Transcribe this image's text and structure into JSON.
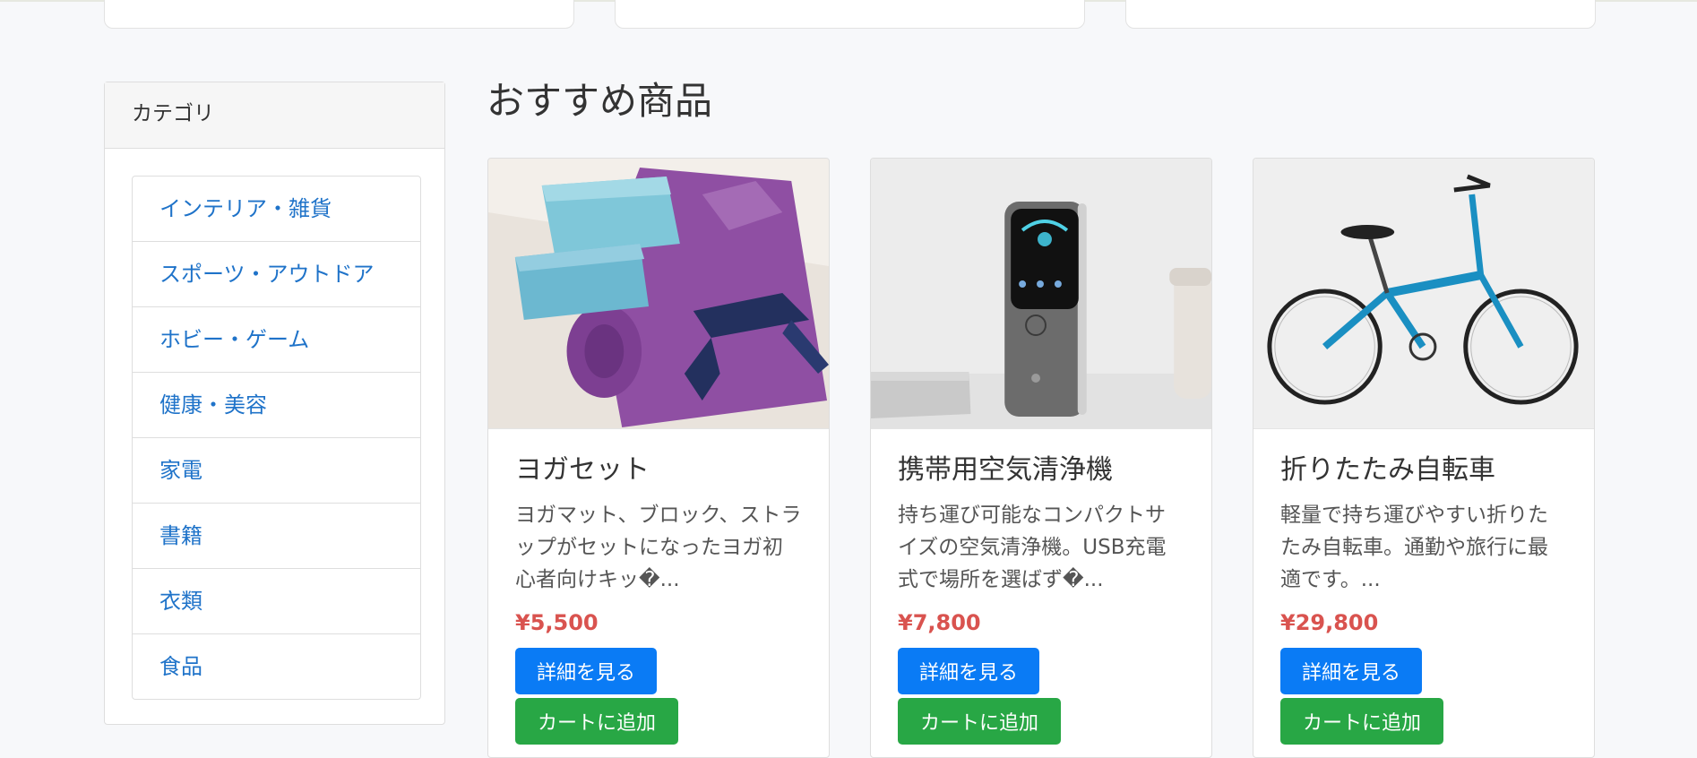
{
  "sidebar": {
    "title": "カテゴリ",
    "items": [
      {
        "label": "インテリア・雑貨"
      },
      {
        "label": "スポーツ・アウトドア"
      },
      {
        "label": "ホビー・ゲーム"
      },
      {
        "label": "健康・美容"
      },
      {
        "label": "家電"
      },
      {
        "label": "書籍"
      },
      {
        "label": "衣類"
      },
      {
        "label": "食品"
      }
    ]
  },
  "main": {
    "title": "おすすめ商品",
    "products": [
      {
        "name": "ヨガセット",
        "description": "ヨガマット、ブロック、ストラップがセットになったヨガ初心者向けキッ�...",
        "price": "¥5,500",
        "detail_label": "詳細を見る",
        "cart_label": "カートに追加",
        "image_icon": "yoga-set-image"
      },
      {
        "name": "携帯用空気清浄機",
        "description": "持ち運び可能なコンパクトサイズの空気清浄機。USB充電式で場所を選ばず�...",
        "price": "¥7,800",
        "detail_label": "詳細を見る",
        "cart_label": "カートに追加",
        "image_icon": "air-purifier-image"
      },
      {
        "name": "折りたたみ自転車",
        "description": "軽量で持ち運びやすい折りたたみ自転車。通勤や旅行に最適です。...",
        "price": "¥29,800",
        "detail_label": "詳細を見る",
        "cart_label": "カートに追加",
        "image_icon": "folding-bike-image"
      }
    ]
  },
  "colors": {
    "link": "#1f73c9",
    "price": "#d9534f",
    "primary_button": "#0a7bf5",
    "success_button": "#28a745",
    "background": "#f7f8fa"
  }
}
